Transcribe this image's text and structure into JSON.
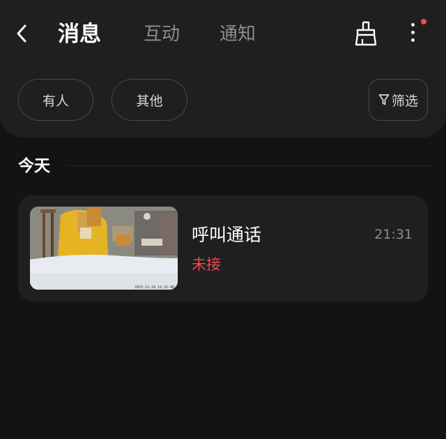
{
  "header": {
    "tabs": [
      {
        "label": "消息",
        "active": true
      },
      {
        "label": "互动",
        "active": false
      },
      {
        "label": "通知",
        "active": false
      }
    ],
    "icons": {
      "back": "chevron-left-icon",
      "clean": "broom-icon",
      "more": "more-vertical-icon"
    },
    "has_unread_badge": true
  },
  "filters": {
    "chips": [
      "有人",
      "其他"
    ],
    "filter_label": "筛选",
    "filter_icon": "funnel-icon"
  },
  "section": {
    "title": "今天"
  },
  "messages": [
    {
      "title": "呼叫通话",
      "status": "未接",
      "time": "21:31",
      "thumbnail_timestamp": "2023-12-24 21:31:40"
    }
  ],
  "colors": {
    "background": "#131315",
    "panel": "#1f1f21",
    "accent_red": "#f2494c",
    "muted_text": "#8e8e92"
  }
}
